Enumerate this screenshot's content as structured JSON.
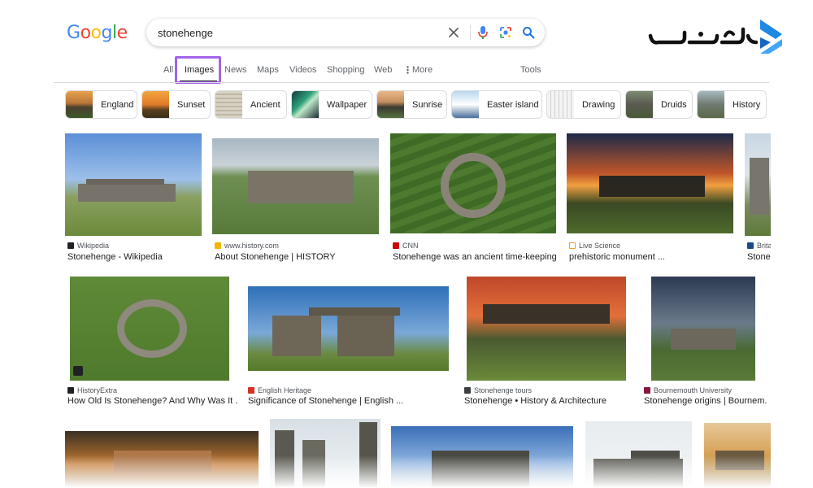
{
  "search": {
    "query": "stonehenge"
  },
  "logo": {
    "letters": [
      "G",
      "o",
      "o",
      "g",
      "l",
      "e"
    ],
    "colors": [
      "#4285f4",
      "#ea4335",
      "#fbbc05",
      "#4285f4",
      "#34a853",
      "#ea4335"
    ]
  },
  "tabs": {
    "all": "All",
    "images": "Images",
    "news": "News",
    "maps": "Maps",
    "videos": "Videos",
    "shopping": "Shopping",
    "web": "Web",
    "more": "More",
    "tools": "Tools"
  },
  "chips": [
    "England",
    "Sunset",
    "Ancient",
    "Wallpaper",
    "Sunrise",
    "Easter island",
    "Drawing",
    "Druids",
    "History"
  ],
  "results": [
    {
      "source": "Wikipedia",
      "title": "Stonehenge - Wikipedia"
    },
    {
      "source": "www.history.com",
      "title": "About Stonehenge | HISTORY"
    },
    {
      "source": "CNN",
      "title": "Stonehenge was an ancient time-keeping ..."
    },
    {
      "source": "Live Science",
      "title": "prehistoric monument ..."
    },
    {
      "source": "Brita",
      "title": "Stonel"
    },
    {
      "source": "HistoryExtra",
      "title": "How Old Is Stonehenge? And Why Was It ..."
    },
    {
      "source": "English Heritage",
      "title": "Significance of Stonehenge | English ..."
    },
    {
      "source": "Stonehenge tours",
      "title": "Stonehenge • History & Architecture"
    },
    {
      "source": "Bournemouth University",
      "title": "Stonehenge origins | Bournem..."
    }
  ],
  "colors": {
    "accent_blue": "#1a73e8",
    "highlight_purple": "#a263e8",
    "brand_blue": "#1e88e5"
  },
  "icons": [
    "clear-icon",
    "microphone-icon",
    "lens-icon",
    "search-icon",
    "more-dots-icon",
    "image-badge-icon"
  ]
}
